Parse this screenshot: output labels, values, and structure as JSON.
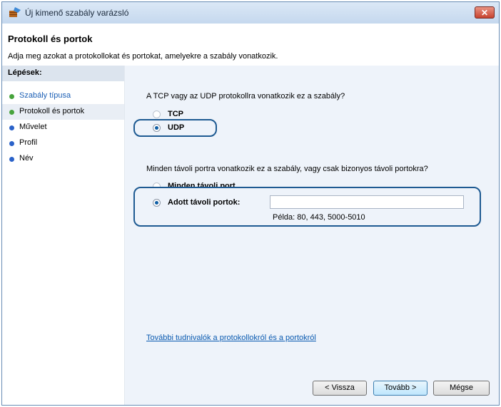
{
  "window": {
    "title": "Új kimenő szabály varázsló",
    "close_label": "✕"
  },
  "header": {
    "title": "Protokoll és portok",
    "description": "Adja meg azokat a protokollokat és portokat, amelyekre a szabály vonatkozik."
  },
  "sidebar": {
    "heading": "Lépések:",
    "items": [
      {
        "label": "Szabály típusa",
        "color": "#47a33c"
      },
      {
        "label": "Protokoll és portok",
        "color": "#47a33c"
      },
      {
        "label": "Művelet",
        "color": "#2a62c9"
      },
      {
        "label": "Profil",
        "color": "#2a62c9"
      },
      {
        "label": "Név",
        "color": "#2a62c9"
      }
    ]
  },
  "main": {
    "protocol_question": "A TCP vagy az UDP protokollra vonatkozik ez a szabály?",
    "protocol_options": [
      {
        "label": "TCP",
        "selected": false
      },
      {
        "label": "UDP",
        "selected": true
      }
    ],
    "ports_question": "Minden távoli portra vonatkozik ez a szabály, vagy csak bizonyos távoli portokra?",
    "port_options": [
      {
        "label": "Minden távoli port",
        "selected": false
      },
      {
        "label": "Adott távoli portok:",
        "selected": true
      }
    ],
    "ports_input_value": "",
    "ports_example": "Példa: 80, 443, 5000-5010",
    "help_link": "További tudnivalók a protokollokról és a portokról"
  },
  "buttons": {
    "back": "< Vissza",
    "next": "Tovább >",
    "cancel": "Mégse"
  }
}
